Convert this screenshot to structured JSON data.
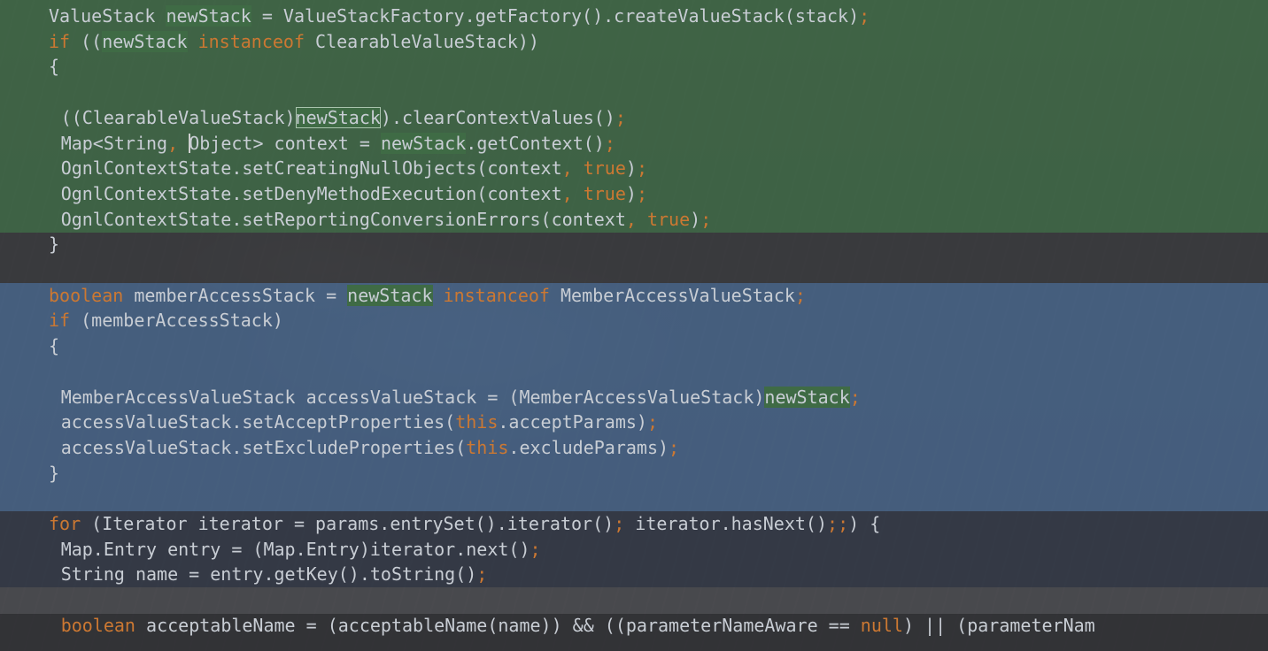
{
  "editor": {
    "colors": {
      "keyword": "#cc7832",
      "text": "#c8cdd4",
      "highlight": "#3f6b45",
      "band_green": "#406a46",
      "band_blue": "#48668c"
    },
    "lines": [
      {
        "indent": 2,
        "segs": [
          [
            "pl",
            "ValueStack "
          ],
          [
            "hl",
            "newStack"
          ],
          [
            "pl",
            " = ValueStackFactory.getFactory().createValueStack(stack)"
          ],
          [
            "pn",
            ";"
          ]
        ]
      },
      {
        "indent": 2,
        "segs": [
          [
            "kw",
            "if"
          ],
          [
            "pl",
            " (("
          ],
          [
            "hl",
            "newStack"
          ],
          [
            "pl",
            " "
          ],
          [
            "kw",
            "instanceof"
          ],
          [
            "pl",
            " ClearableValueStack))"
          ]
        ]
      },
      {
        "indent": 2,
        "segs": [
          [
            "pl",
            "{"
          ]
        ]
      },
      {
        "indent": 2,
        "segs": []
      },
      {
        "indent": 3,
        "segs": [
          [
            "pl",
            "((ClearableValueStack)"
          ],
          [
            "box",
            "newStack"
          ],
          [
            "pl",
            ").clearContextValues()"
          ],
          [
            "pn",
            ";"
          ]
        ]
      },
      {
        "indent": 3,
        "segs": [
          [
            "pl",
            "Map<String"
          ],
          [
            "pn",
            ","
          ],
          [
            "pl",
            " "
          ],
          [
            "caret",
            ""
          ],
          [
            "pl",
            "Object> context = "
          ],
          [
            "hl",
            "newStack"
          ],
          [
            "pl",
            ".getContext()"
          ],
          [
            "pn",
            ";"
          ]
        ]
      },
      {
        "indent": 3,
        "segs": [
          [
            "pl",
            "OgnlContextState.setCreatingNullObjects(context"
          ],
          [
            "pn",
            ","
          ],
          [
            "pl",
            " "
          ],
          [
            "kw",
            "true"
          ],
          [
            "pl",
            ")"
          ],
          [
            "pn",
            ";"
          ]
        ]
      },
      {
        "indent": 3,
        "segs": [
          [
            "pl",
            "OgnlContextState.setDenyMethodExecution(context"
          ],
          [
            "pn",
            ","
          ],
          [
            "pl",
            " "
          ],
          [
            "kw",
            "true"
          ],
          [
            "pl",
            ")"
          ],
          [
            "pn",
            ";"
          ]
        ]
      },
      {
        "indent": 3,
        "segs": [
          [
            "pl",
            "OgnlContextState.setReportingConversionErrors(context"
          ],
          [
            "pn",
            ","
          ],
          [
            "pl",
            " "
          ],
          [
            "kw",
            "true"
          ],
          [
            "pl",
            ")"
          ],
          [
            "pn",
            ";"
          ]
        ]
      },
      {
        "indent": 2,
        "segs": [
          [
            "pl",
            "}"
          ]
        ]
      },
      {
        "indent": 2,
        "segs": []
      },
      {
        "indent": 2,
        "segs": [
          [
            "kw",
            "boolean"
          ],
          [
            "pl",
            " memberAccessStack = "
          ],
          [
            "hl",
            "newStack"
          ],
          [
            "pl",
            " "
          ],
          [
            "kw",
            "instanceof"
          ],
          [
            "pl",
            " MemberAccessValueStack"
          ],
          [
            "pn",
            ";"
          ]
        ]
      },
      {
        "indent": 2,
        "segs": [
          [
            "kw",
            "if"
          ],
          [
            "pl",
            " (memberAccessStack)"
          ]
        ]
      },
      {
        "indent": 2,
        "segs": [
          [
            "pl",
            "{"
          ]
        ]
      },
      {
        "indent": 2,
        "segs": []
      },
      {
        "indent": 3,
        "segs": [
          [
            "pl",
            "MemberAccessValueStack accessValueStack = (MemberAccessValueStack)"
          ],
          [
            "hl",
            "newStack"
          ],
          [
            "pn",
            ";"
          ]
        ]
      },
      {
        "indent": 3,
        "segs": [
          [
            "pl",
            "accessValueStack.setAcceptProperties("
          ],
          [
            "kw",
            "this"
          ],
          [
            "pl",
            ".acceptParams)"
          ],
          [
            "pn",
            ";"
          ]
        ]
      },
      {
        "indent": 3,
        "segs": [
          [
            "pl",
            "accessValueStack.setExcludeProperties("
          ],
          [
            "kw",
            "this"
          ],
          [
            "pl",
            ".excludeParams)"
          ],
          [
            "pn",
            ";"
          ]
        ]
      },
      {
        "indent": 2,
        "segs": [
          [
            "pl",
            "}"
          ]
        ]
      },
      {
        "indent": 2,
        "segs": []
      },
      {
        "indent": 2,
        "segs": [
          [
            "kw",
            "for"
          ],
          [
            "pl",
            " (Iterator iterator = params.entrySet().iterator()"
          ],
          [
            "pn",
            ";"
          ],
          [
            "pl",
            " iterator.hasNext()"
          ],
          [
            "pn",
            ";"
          ],
          [
            "pn",
            ";"
          ],
          [
            "pl",
            ") {"
          ]
        ]
      },
      {
        "indent": 3,
        "segs": [
          [
            "pl",
            "Map.Entry entry = (Map.Entry)iterator.next()"
          ],
          [
            "pn",
            ";"
          ]
        ]
      },
      {
        "indent": 3,
        "segs": [
          [
            "pl",
            "String name = entry.getKey().toString()"
          ],
          [
            "pn",
            ";"
          ]
        ]
      },
      {
        "indent": 3,
        "segs": []
      },
      {
        "indent": 3,
        "segs": [
          [
            "kw",
            "boolean"
          ],
          [
            "pl",
            " acceptableName = (acceptableName(name)) && ((parameterNameAware == "
          ],
          [
            "kw",
            "null"
          ],
          [
            "pl",
            ") || (parameterNam"
          ]
        ]
      }
    ]
  }
}
